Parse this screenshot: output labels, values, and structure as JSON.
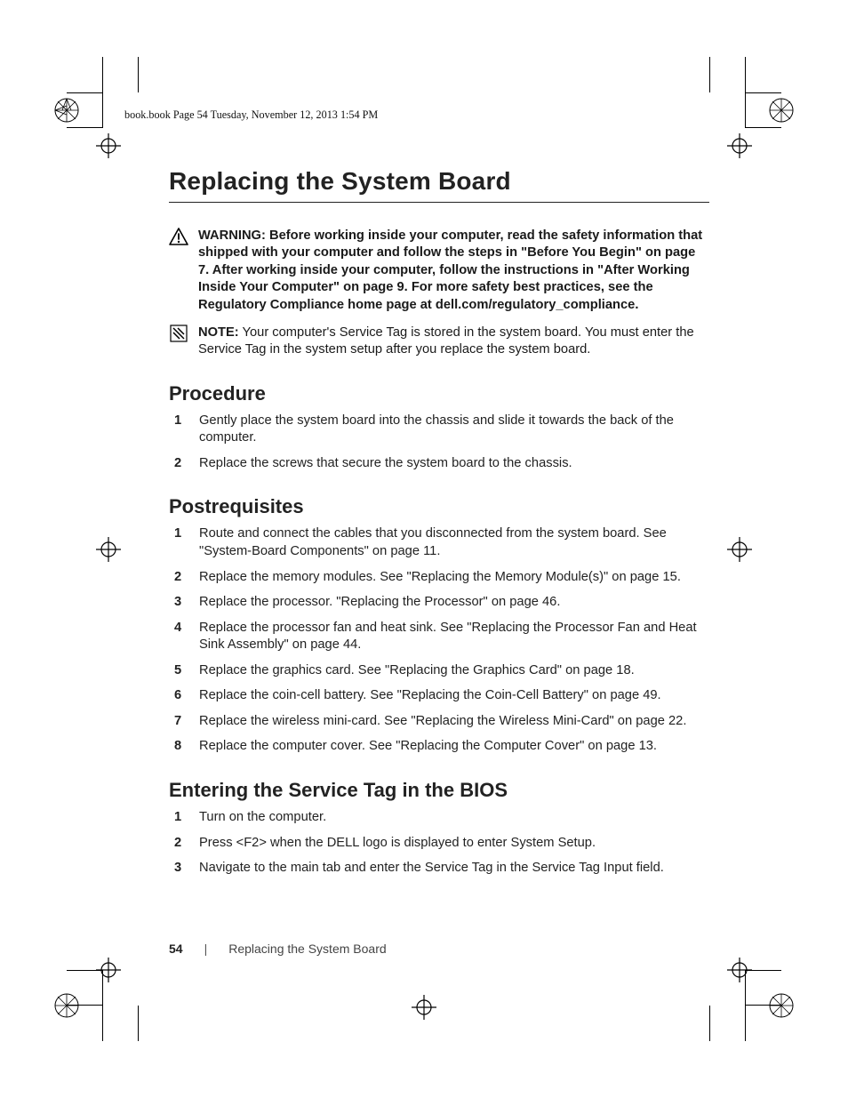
{
  "header_line": "book.book  Page 54  Tuesday, November 12, 2013  1:54 PM",
  "title": "Replacing the System Board",
  "warning": {
    "label": "WARNING:",
    "text": "Before working inside your computer, read the safety information that shipped with your computer and follow the steps in \"Before You Begin\" on page 7. After working inside your computer, follow the instructions in \"After Working Inside Your Computer\" on page 9. For more safety best practices, see the Regulatory Compliance home page at dell.com/regulatory_compliance."
  },
  "note": {
    "label": "NOTE:",
    "text": "Your computer's Service Tag is stored in the system board. You must enter the Service Tag in the system setup after you replace the system board."
  },
  "sections": {
    "procedure": {
      "heading": "Procedure",
      "steps": [
        "Gently place the system board into the chassis and slide it towards the back of the computer.",
        "Replace the screws that secure the system board to the chassis."
      ]
    },
    "postrequisites": {
      "heading": "Postrequisites",
      "steps": [
        "Route and connect the cables that you disconnected from the system board. See \"System-Board Components\" on page 11.",
        "Replace the memory modules. See \"Replacing the Memory Module(s)\" on page 15.",
        "Replace the processor. \"Replacing the Processor\" on page 46.",
        "Replace the processor fan and heat sink. See \"Replacing the Processor Fan and Heat Sink Assembly\" on page 44.",
        "Replace the graphics card. See \"Replacing the Graphics Card\" on page 18.",
        "Replace the coin-cell battery. See \"Replacing the Coin-Cell Battery\" on page 49.",
        "Replace the wireless mini-card. See \"Replacing the Wireless Mini-Card\" on page 22.",
        "Replace the computer cover. See \"Replacing the Computer Cover\" on page 13."
      ]
    },
    "bios": {
      "heading": "Entering the Service Tag in the BIOS",
      "step1": "Turn on the computer.",
      "step2": "Press <F2> when the DELL logo is displayed to enter System Setup.",
      "step3_prefix": "Navigate to the main tab and enter the Service Tag in the ",
      "step3_bold": "Service Tag Input",
      "step3_suffix": " field."
    }
  },
  "footer": {
    "page_number": "54",
    "divider": "|",
    "section_title": "Replacing the System Board"
  }
}
